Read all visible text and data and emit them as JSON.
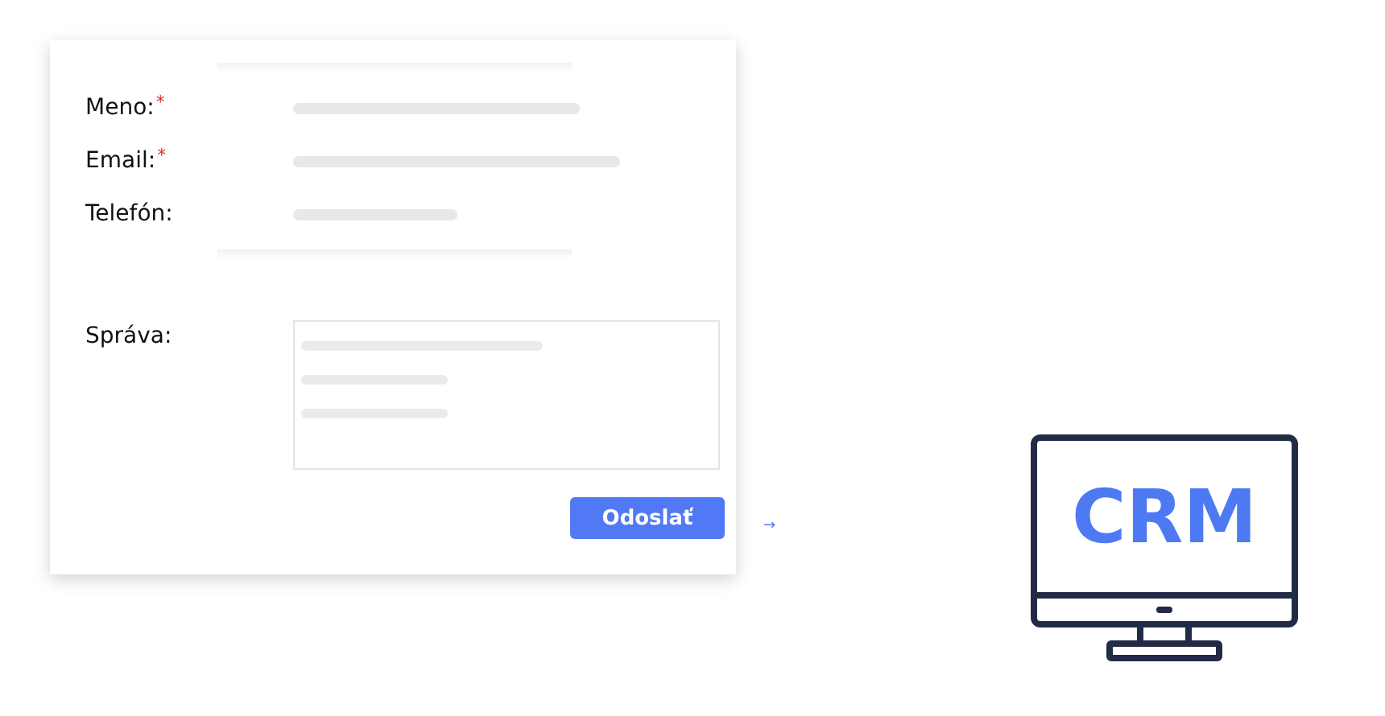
{
  "form": {
    "fields": [
      {
        "label": "Meno:",
        "required": true
      },
      {
        "label": "Email:",
        "required": true
      },
      {
        "label": "Telefón:",
        "required": false
      }
    ],
    "message_label": "Správa:",
    "required_mark": "*",
    "submit": "Odoslať"
  },
  "arrow": "→",
  "monitor": {
    "text": "CRM"
  }
}
